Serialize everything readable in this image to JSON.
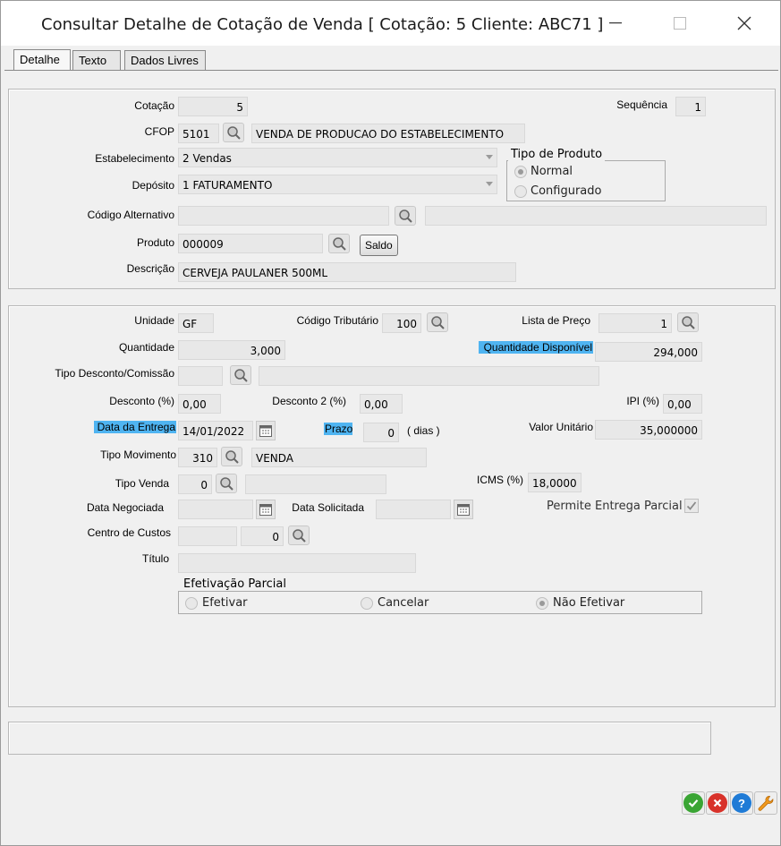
{
  "window": {
    "title": "Consultar Detalhe de Cotação de Venda [ Cotação: 5  Cliente: ABC71 ]",
    "minimize": "—",
    "close": "✕"
  },
  "tabs": [
    "Detalhe",
    "Texto",
    "Dados Livres"
  ],
  "section1": {
    "cotacao_label": "Cotação",
    "cotacao": "5",
    "sequencia_label": "Sequência",
    "sequencia": "1",
    "cfop_label": "CFOP",
    "cfop_code": "5101",
    "cfop_desc": "VENDA DE PRODUCAO DO ESTABELECIMENTO",
    "estabelecimento_label": "Estabelecimento",
    "estabelecimento": "2 Vendas",
    "deposito_label": "Depósito",
    "deposito": "1 FATURAMENTO",
    "tipo_produto_title": "Tipo de Produto",
    "tipo_produto_options": [
      "Normal",
      "Configurado"
    ],
    "tipo_produto_selected": "Normal",
    "codigo_alternativo_label": "Código Alternativo",
    "codigo_alternativo": "",
    "codigo_alternativo_desc": "",
    "produto_label": "Produto",
    "produto": "000009",
    "saldo_button": "Saldo",
    "descricao_label": "Descrição",
    "descricao": "CERVEJA PAULANER 500ML"
  },
  "section2": {
    "unidade_label": "Unidade",
    "unidade": "GF",
    "codigo_tributario_label": "Código Tributário",
    "codigo_tributario": "100",
    "lista_preco_label": "Lista de Preço",
    "lista_preco": "1",
    "quantidade_label": "Quantidade",
    "quantidade": "3,000",
    "qtd_disponivel_label": "Quantidade Disponível",
    "qtd_disponivel": "294,000",
    "tipo_desconto_label": "Tipo Desconto/Comissão",
    "tipo_desconto": "",
    "tipo_desconto_desc": "",
    "desconto_label": "Desconto (%)",
    "desconto": "0,00",
    "desconto2_label": "Desconto 2 (%)",
    "desconto2": "0,00",
    "ipi_label": "IPI (%)",
    "ipi": "0,00",
    "data_entrega_label": "Data da Entrega",
    "data_entrega": "14/01/2022",
    "prazo_label": "Prazo",
    "prazo": "0",
    "prazo_unit": "( dias )",
    "valor_unitario_label": "Valor Unitário",
    "valor_unitario": "35,000000",
    "tipo_movimento_label": "Tipo Movimento",
    "tipo_movimento": "310",
    "tipo_movimento_desc": "VENDA",
    "tipo_venda_label": "Tipo Venda",
    "tipo_venda": "0",
    "tipo_venda_desc": "",
    "icms_label": "ICMS (%)",
    "icms": "18,0000",
    "data_negociada_label": "Data Negociada",
    "data_negociada": "",
    "data_solicitada_label": "Data Solicitada",
    "data_solicitada": "",
    "permite_entrega_label": "Permite Entrega Parcial",
    "permite_entrega_checked": true,
    "centro_custos_label": "Centro de Custos",
    "centro_custos_a": "",
    "centro_custos_b": "0",
    "titulo_label": "Título",
    "titulo": "",
    "efetivacao_title": "Efetivação Parcial",
    "efetivacao_options": [
      "Efetivar",
      "Cancelar",
      "Não Efetivar"
    ],
    "efetivacao_selected": "Não Efetivar"
  },
  "footer": {
    "status": "",
    "icons": [
      "ok-icon",
      "cancel-icon",
      "help-icon",
      "tools-icon"
    ],
    "colors": {
      "ok": "#3aa534",
      "cancel": "#d8322a",
      "help": "#1f7bd6",
      "tools": "#f29a1d"
    }
  },
  "accent_highlight": "#4fb4f1"
}
